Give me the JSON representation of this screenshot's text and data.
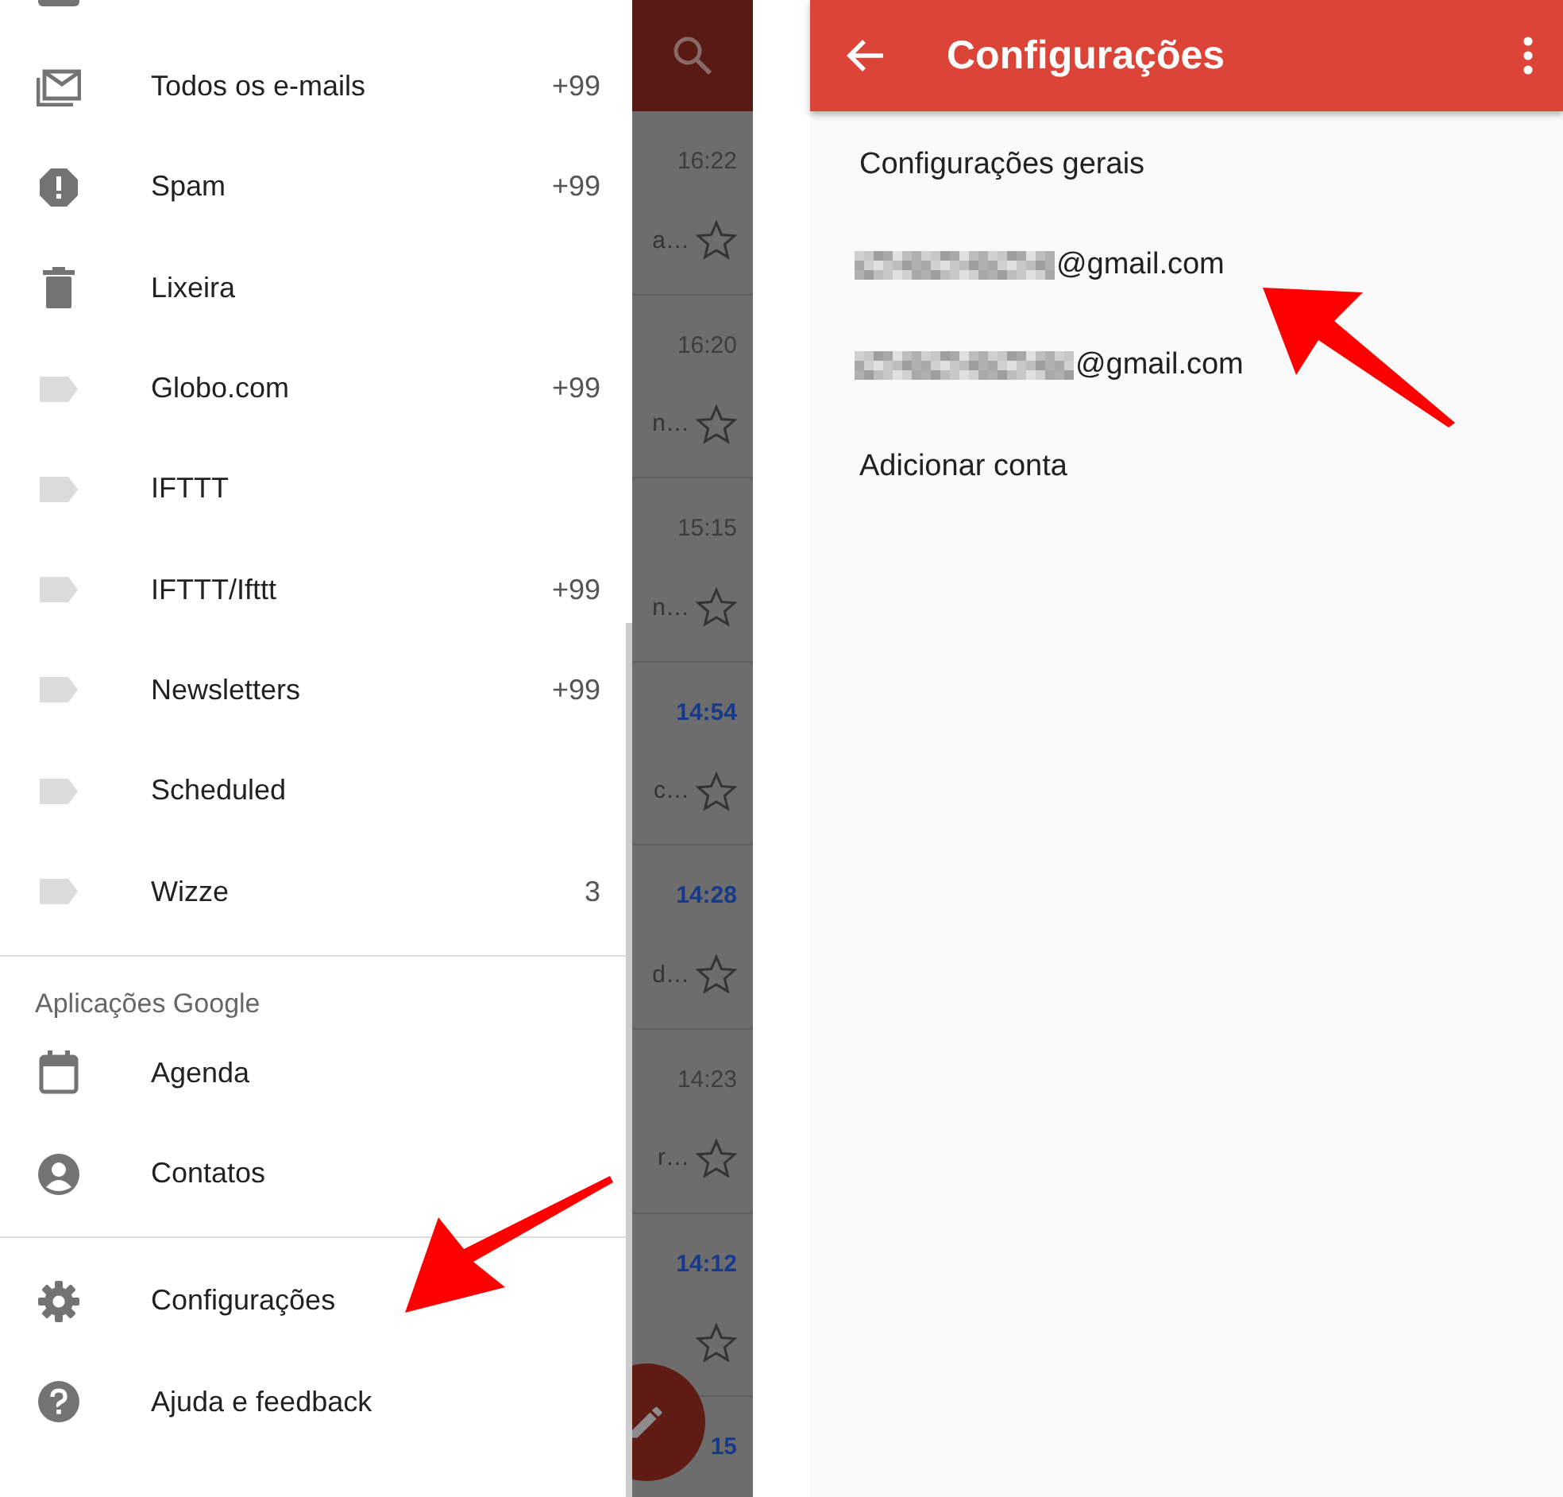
{
  "drawer": {
    "items": [
      {
        "kind": "all-mail",
        "label": "Todos os e-mails",
        "count": "+99"
      },
      {
        "kind": "spam",
        "label": "Spam",
        "count": "+99"
      },
      {
        "kind": "trash",
        "label": "Lixeira"
      },
      {
        "kind": "label",
        "label": "Globo.com",
        "count": "+99"
      },
      {
        "kind": "label",
        "label": "IFTTT"
      },
      {
        "kind": "label",
        "label": "IFTTT/Ifttt",
        "count": "+99"
      },
      {
        "kind": "label",
        "label": "Newsletters",
        "count": "+99"
      },
      {
        "kind": "label",
        "label": "Scheduled"
      },
      {
        "kind": "label",
        "label": "Wizze",
        "count": "3"
      }
    ],
    "apps_section": {
      "title": "Aplicações Google",
      "items": [
        {
          "kind": "calendar",
          "label": "Agenda"
        },
        {
          "kind": "contacts",
          "label": "Contatos"
        }
      ]
    },
    "footer_items": [
      {
        "kind": "settings",
        "label": "Configurações"
      },
      {
        "kind": "help",
        "label": "Ajuda e feedback"
      }
    ]
  },
  "mail_list": {
    "rows": [
      {
        "time": "16:22",
        "unread": false,
        "snippet": "a…"
      },
      {
        "time": "16:20",
        "unread": false,
        "snippet": "n…"
      },
      {
        "time": "15:15",
        "unread": false,
        "snippet": "n…"
      },
      {
        "time": "14:54",
        "unread": true,
        "snippet": "c…"
      },
      {
        "time": "14:28",
        "unread": true,
        "snippet": "d…"
      },
      {
        "time": "14:23",
        "unread": false,
        "snippet": "r…"
      },
      {
        "time": "14:12",
        "unread": true
      },
      {
        "time": "15",
        "unread": true
      }
    ]
  },
  "settings": {
    "title": "Configurações",
    "items": [
      {
        "kind": "text",
        "label": "Configurações gerais"
      },
      {
        "kind": "account",
        "label": "@gmail.com"
      },
      {
        "kind": "account",
        "label": "@gmail.com"
      },
      {
        "kind": "text",
        "label": "Adicionar conta"
      }
    ]
  }
}
